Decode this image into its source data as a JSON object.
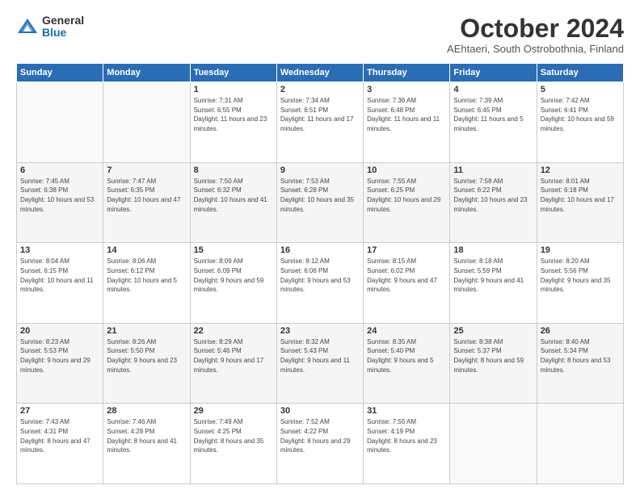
{
  "logo": {
    "general": "General",
    "blue": "Blue"
  },
  "title": {
    "month": "October 2024",
    "location": "AEhtaeri, South Ostrobothnia, Finland"
  },
  "headers": [
    "Sunday",
    "Monday",
    "Tuesday",
    "Wednesday",
    "Thursday",
    "Friday",
    "Saturday"
  ],
  "weeks": [
    [
      {
        "day": "",
        "sunrise": "",
        "sunset": "",
        "daylight": ""
      },
      {
        "day": "",
        "sunrise": "",
        "sunset": "",
        "daylight": ""
      },
      {
        "day": "1",
        "sunrise": "Sunrise: 7:31 AM",
        "sunset": "Sunset: 6:55 PM",
        "daylight": "Daylight: 11 hours and 23 minutes."
      },
      {
        "day": "2",
        "sunrise": "Sunrise: 7:34 AM",
        "sunset": "Sunset: 6:51 PM",
        "daylight": "Daylight: 11 hours and 17 minutes."
      },
      {
        "day": "3",
        "sunrise": "Sunrise: 7:36 AM",
        "sunset": "Sunset: 6:48 PM",
        "daylight": "Daylight: 11 hours and 11 minutes."
      },
      {
        "day": "4",
        "sunrise": "Sunrise: 7:39 AM",
        "sunset": "Sunset: 6:45 PM",
        "daylight": "Daylight: 11 hours and 5 minutes."
      },
      {
        "day": "5",
        "sunrise": "Sunrise: 7:42 AM",
        "sunset": "Sunset: 6:41 PM",
        "daylight": "Daylight: 10 hours and 59 minutes."
      }
    ],
    [
      {
        "day": "6",
        "sunrise": "Sunrise: 7:45 AM",
        "sunset": "Sunset: 6:38 PM",
        "daylight": "Daylight: 10 hours and 53 minutes."
      },
      {
        "day": "7",
        "sunrise": "Sunrise: 7:47 AM",
        "sunset": "Sunset: 6:35 PM",
        "daylight": "Daylight: 10 hours and 47 minutes."
      },
      {
        "day": "8",
        "sunrise": "Sunrise: 7:50 AM",
        "sunset": "Sunset: 6:32 PM",
        "daylight": "Daylight: 10 hours and 41 minutes."
      },
      {
        "day": "9",
        "sunrise": "Sunrise: 7:53 AM",
        "sunset": "Sunset: 6:28 PM",
        "daylight": "Daylight: 10 hours and 35 minutes."
      },
      {
        "day": "10",
        "sunrise": "Sunrise: 7:55 AM",
        "sunset": "Sunset: 6:25 PM",
        "daylight": "Daylight: 10 hours and 29 minutes."
      },
      {
        "day": "11",
        "sunrise": "Sunrise: 7:58 AM",
        "sunset": "Sunset: 6:22 PM",
        "daylight": "Daylight: 10 hours and 23 minutes."
      },
      {
        "day": "12",
        "sunrise": "Sunrise: 8:01 AM",
        "sunset": "Sunset: 6:18 PM",
        "daylight": "Daylight: 10 hours and 17 minutes."
      }
    ],
    [
      {
        "day": "13",
        "sunrise": "Sunrise: 8:04 AM",
        "sunset": "Sunset: 6:15 PM",
        "daylight": "Daylight: 10 hours and 11 minutes."
      },
      {
        "day": "14",
        "sunrise": "Sunrise: 8:06 AM",
        "sunset": "Sunset: 6:12 PM",
        "daylight": "Daylight: 10 hours and 5 minutes."
      },
      {
        "day": "15",
        "sunrise": "Sunrise: 8:09 AM",
        "sunset": "Sunset: 6:09 PM",
        "daylight": "Daylight: 9 hours and 59 minutes."
      },
      {
        "day": "16",
        "sunrise": "Sunrise: 8:12 AM",
        "sunset": "Sunset: 6:06 PM",
        "daylight": "Daylight: 9 hours and 53 minutes."
      },
      {
        "day": "17",
        "sunrise": "Sunrise: 8:15 AM",
        "sunset": "Sunset: 6:02 PM",
        "daylight": "Daylight: 9 hours and 47 minutes."
      },
      {
        "day": "18",
        "sunrise": "Sunrise: 8:18 AM",
        "sunset": "Sunset: 5:59 PM",
        "daylight": "Daylight: 9 hours and 41 minutes."
      },
      {
        "day": "19",
        "sunrise": "Sunrise: 8:20 AM",
        "sunset": "Sunset: 5:56 PM",
        "daylight": "Daylight: 9 hours and 35 minutes."
      }
    ],
    [
      {
        "day": "20",
        "sunrise": "Sunrise: 8:23 AM",
        "sunset": "Sunset: 5:53 PM",
        "daylight": "Daylight: 9 hours and 29 minutes."
      },
      {
        "day": "21",
        "sunrise": "Sunrise: 8:26 AM",
        "sunset": "Sunset: 5:50 PM",
        "daylight": "Daylight: 9 hours and 23 minutes."
      },
      {
        "day": "22",
        "sunrise": "Sunrise: 8:29 AM",
        "sunset": "Sunset: 5:46 PM",
        "daylight": "Daylight: 9 hours and 17 minutes."
      },
      {
        "day": "23",
        "sunrise": "Sunrise: 8:32 AM",
        "sunset": "Sunset: 5:43 PM",
        "daylight": "Daylight: 9 hours and 11 minutes."
      },
      {
        "day": "24",
        "sunrise": "Sunrise: 8:35 AM",
        "sunset": "Sunset: 5:40 PM",
        "daylight": "Daylight: 9 hours and 5 minutes."
      },
      {
        "day": "25",
        "sunrise": "Sunrise: 8:38 AM",
        "sunset": "Sunset: 5:37 PM",
        "daylight": "Daylight: 8 hours and 59 minutes."
      },
      {
        "day": "26",
        "sunrise": "Sunrise: 8:40 AM",
        "sunset": "Sunset: 5:34 PM",
        "daylight": "Daylight: 8 hours and 53 minutes."
      }
    ],
    [
      {
        "day": "27",
        "sunrise": "Sunrise: 7:43 AM",
        "sunset": "Sunset: 4:31 PM",
        "daylight": "Daylight: 8 hours and 47 minutes."
      },
      {
        "day": "28",
        "sunrise": "Sunrise: 7:46 AM",
        "sunset": "Sunset: 4:28 PM",
        "daylight": "Daylight: 8 hours and 41 minutes."
      },
      {
        "day": "29",
        "sunrise": "Sunrise: 7:49 AM",
        "sunset": "Sunset: 4:25 PM",
        "daylight": "Daylight: 8 hours and 35 minutes."
      },
      {
        "day": "30",
        "sunrise": "Sunrise: 7:52 AM",
        "sunset": "Sunset: 4:22 PM",
        "daylight": "Daylight: 8 hours and 29 minutes."
      },
      {
        "day": "31",
        "sunrise": "Sunrise: 7:55 AM",
        "sunset": "Sunset: 4:19 PM",
        "daylight": "Daylight: 8 hours and 23 minutes."
      },
      {
        "day": "",
        "sunrise": "",
        "sunset": "",
        "daylight": ""
      },
      {
        "day": "",
        "sunrise": "",
        "sunset": "",
        "daylight": ""
      }
    ]
  ]
}
